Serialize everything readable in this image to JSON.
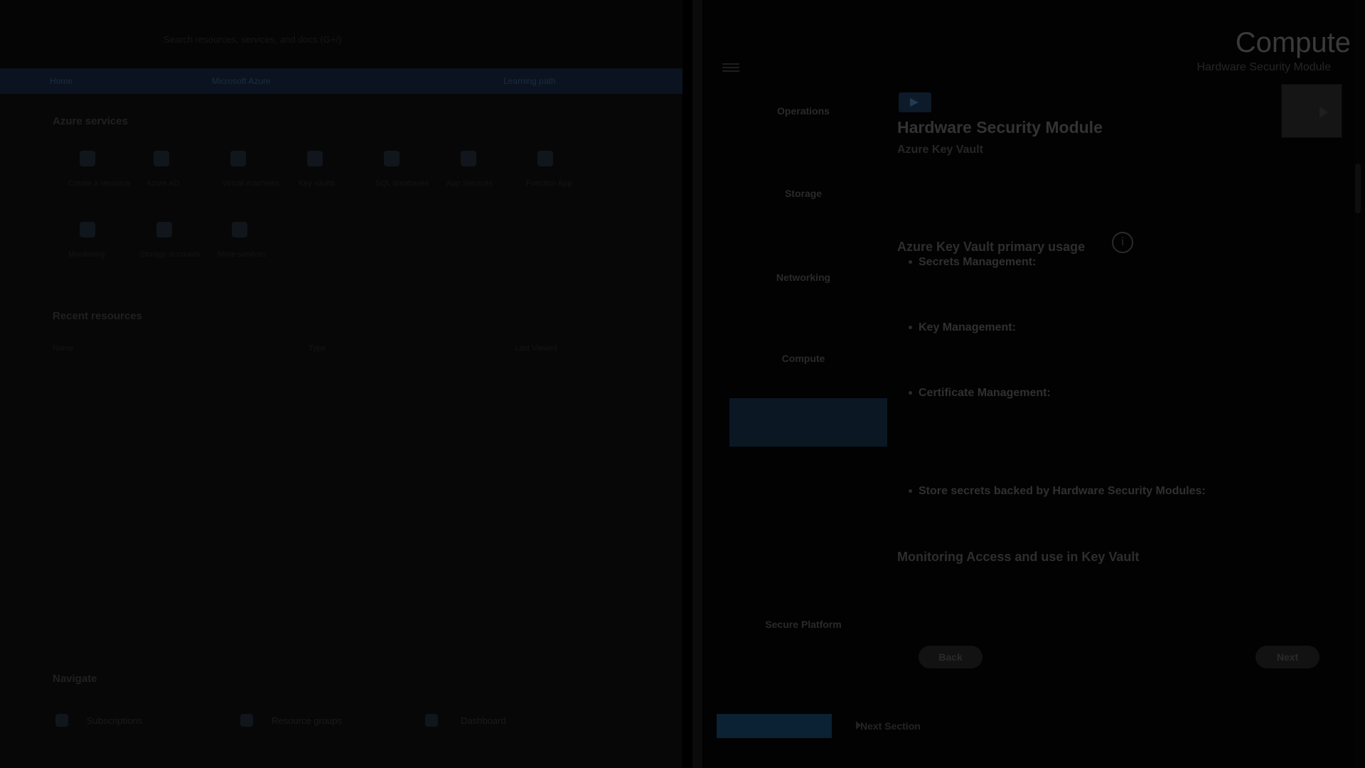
{
  "portal": {
    "search_text": "Search resources, services, and docs (G+/)",
    "tabs": [
      "Home",
      "Microsoft Azure",
      "Learning path"
    ],
    "azure_services_heading": "Azure services",
    "services": [
      {
        "label": "Create a resource",
        "icon": "plus-icon"
      },
      {
        "label": "Azure AD",
        "icon": "azure-ad-icon"
      },
      {
        "label": "Virtual machines",
        "icon": "vm-icon"
      },
      {
        "label": "Key vaults",
        "icon": "key-vault-icon"
      },
      {
        "label": "SQL databases",
        "icon": "sql-icon"
      },
      {
        "label": "App Services",
        "icon": "app-service-icon"
      },
      {
        "label": "Function App",
        "icon": "function-icon"
      },
      {
        "label": "Monitoring",
        "icon": "monitor-icon"
      },
      {
        "label": "Storage accounts",
        "icon": "storage-icon"
      },
      {
        "label": "More services",
        "icon": "arrow-right-icon"
      }
    ],
    "recent_heading": "Recent resources",
    "recent_columns": [
      "Name",
      "Type",
      "Last Viewed"
    ],
    "recent_rows": [
      {
        "name": "",
        "type": "",
        "viewed": ""
      },
      {
        "name": "",
        "type": "",
        "viewed": ""
      },
      {
        "name": "",
        "type": "",
        "viewed": ""
      },
      {
        "name": "",
        "type": "",
        "viewed": ""
      },
      {
        "name": "",
        "type": "",
        "viewed": ""
      },
      {
        "name": "",
        "type": "",
        "viewed": ""
      },
      {
        "name": "",
        "type": "",
        "viewed": ""
      },
      {
        "name": "",
        "type": "",
        "viewed": ""
      },
      {
        "name": "",
        "type": "",
        "viewed": ""
      },
      {
        "name": "",
        "type": "",
        "viewed": ""
      },
      {
        "name": "",
        "type": "",
        "viewed": ""
      },
      {
        "name": "",
        "type": "",
        "viewed": ""
      }
    ],
    "navigate_heading": "Navigate",
    "navigate_items": [
      "Subscriptions",
      "Resource groups",
      "Dashboard"
    ]
  },
  "course": {
    "title": "Compute",
    "subtitle": "Hardware Security Module",
    "nav": [
      {
        "label": "Operations",
        "sub": ""
      },
      {
        "label": "Storage",
        "sub": ""
      },
      {
        "label": "Networking",
        "sub": ""
      },
      {
        "label": "Compute",
        "sub": ""
      },
      {
        "label": "Secure Platform",
        "sub": ""
      }
    ],
    "active_item_lines": [
      "",
      ""
    ],
    "heading": "Hardware Security Module",
    "intro_pre": "",
    "intro_kv": "Azure Key Vault",
    "intro_post": "",
    "usage_heading": "Azure Key Vault primary usage",
    "bullets": [
      {
        "title": "Secrets Management:",
        "text": ""
      },
      {
        "title": "Key Management:",
        "text": ""
      },
      {
        "title": "Certificate Management:",
        "text": ""
      },
      {
        "title": "Store secrets backed by Hardware Security Modules:",
        "text": ""
      }
    ],
    "monitoring_heading": "Monitoring Access and use in Key Vault",
    "monitoring_text": "",
    "back_label": "Back",
    "next_label": "Next",
    "back_course_label": "",
    "next_section_label": "Next Section"
  }
}
